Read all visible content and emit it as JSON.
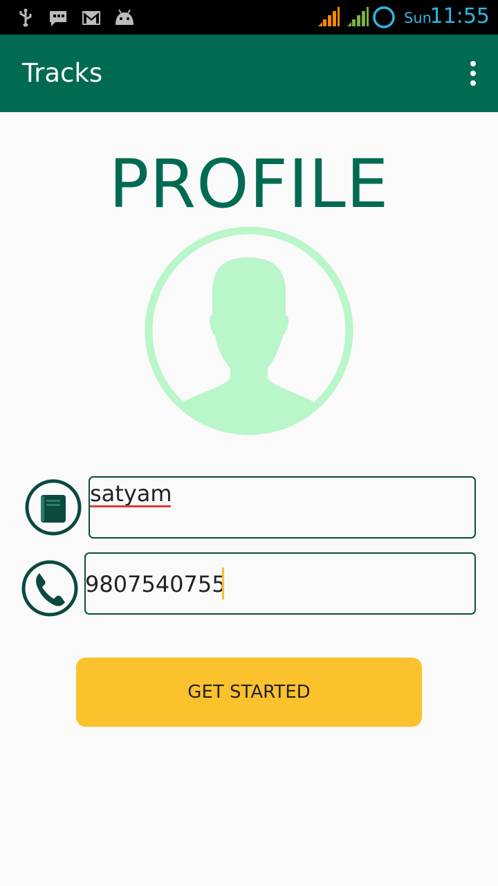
{
  "status_bar": {
    "day": "Sun",
    "time": "11:55",
    "icons": [
      "usb-icon",
      "sms-icon",
      "gmail-icon",
      "android-icon",
      "signal-orange-icon",
      "signal-green-icon",
      "sync-ring-icon"
    ],
    "accent_color": "#33b5e5"
  },
  "app_bar": {
    "title": "Tracks",
    "menu_icon": "overflow-menu-icon",
    "color": "#006a52"
  },
  "page": {
    "heading": "PROFILE",
    "avatar_icon": "user-avatar-icon",
    "avatar_color": "#b9f6ca"
  },
  "form": {
    "name_icon": "contact-book-icon",
    "name_value": "satyam",
    "phone_icon": "phone-icon",
    "phone_value": "9807540755"
  },
  "actions": {
    "get_started_label": "GET STARTED",
    "button_color": "#fbc22e"
  }
}
